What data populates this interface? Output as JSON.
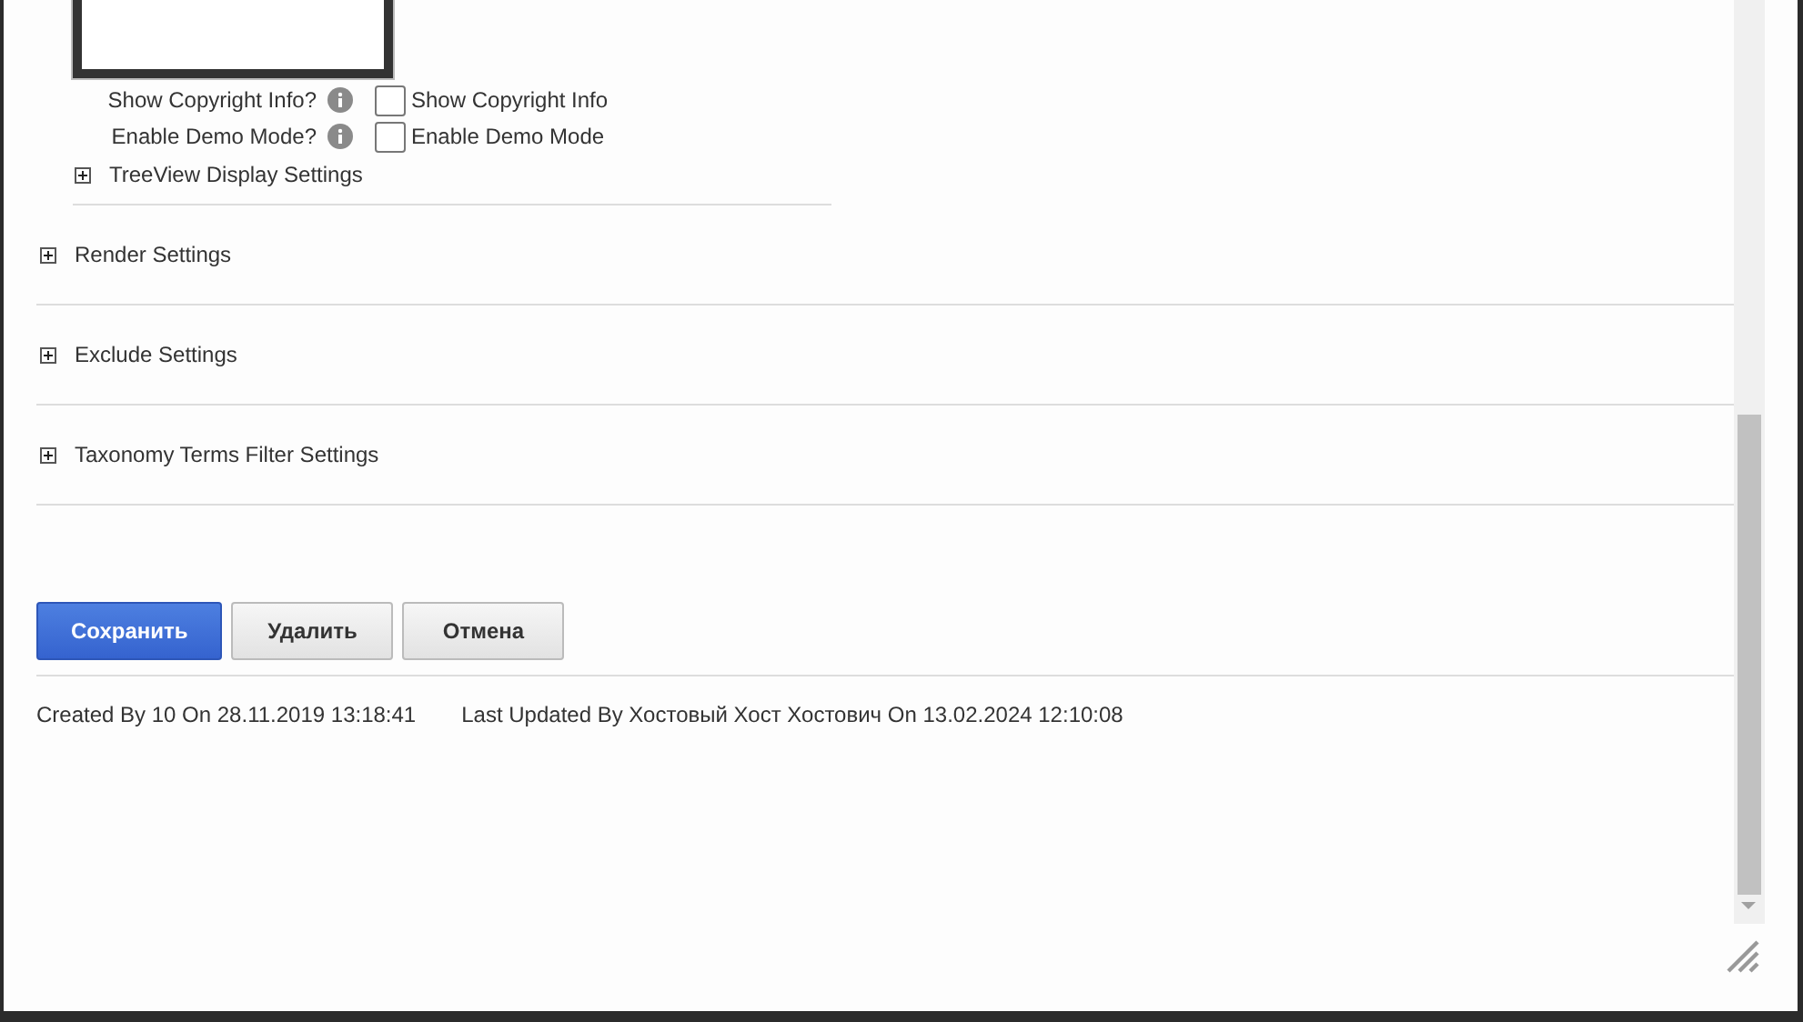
{
  "options": [
    {
      "label": "Show Copyright Info?",
      "checkbox_label": "Show Copyright Info",
      "checked": false
    },
    {
      "label": "Enable Demo Mode?",
      "checkbox_label": "Enable Demo Mode",
      "checked": false
    }
  ],
  "subsection": {
    "label": "TreeView Display Settings",
    "expanded": false
  },
  "sections": [
    {
      "label": "Render Settings",
      "expanded": false
    },
    {
      "label": "Exclude Settings",
      "expanded": false
    },
    {
      "label": "Taxonomy Terms Filter Settings",
      "expanded": false
    }
  ],
  "buttons": [
    {
      "label": "Сохранить",
      "kind": "primary"
    },
    {
      "label": "Удалить",
      "kind": "default"
    },
    {
      "label": "Отмена",
      "kind": "default"
    }
  ],
  "footer": {
    "created": "Created By 10 On 28.11.2019 13:18:41",
    "updated": "Last Updated By Хостовый Хост Хостович On 13.02.2024 12:10:08"
  }
}
